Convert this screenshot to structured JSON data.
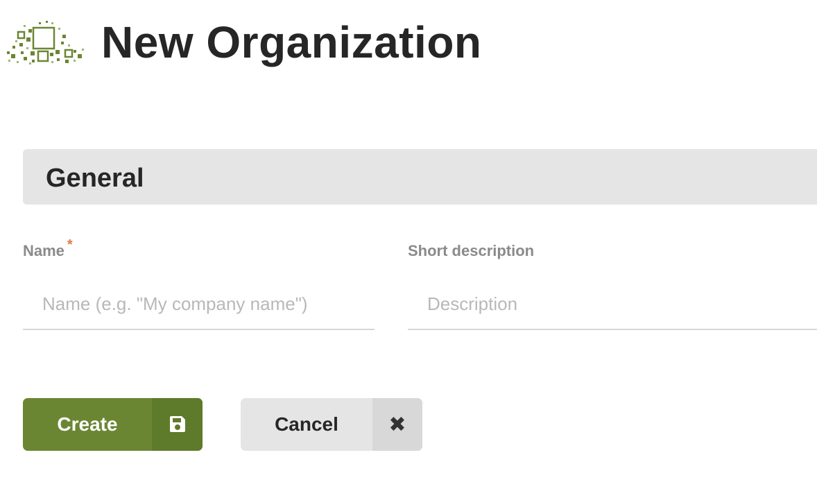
{
  "header": {
    "title": "New Organization",
    "logo_icon": "pixel-squares-logo"
  },
  "section": {
    "title": "General"
  },
  "form": {
    "name": {
      "label": "Name",
      "required_marker": "*",
      "value": "",
      "placeholder": "Name (e.g. \"My company name\")"
    },
    "description": {
      "label": "Short description",
      "value": "",
      "placeholder": "Description"
    }
  },
  "actions": {
    "create_label": "Create",
    "create_icon": "save-icon",
    "cancel_label": "Cancel",
    "cancel_icon": "close-icon",
    "cancel_icon_glyph": "✖"
  },
  "colors": {
    "accent_green": "#6b8633",
    "accent_green_dark": "#5e7a2b",
    "required": "#e0794a",
    "section_bg": "#e5e5e5"
  }
}
